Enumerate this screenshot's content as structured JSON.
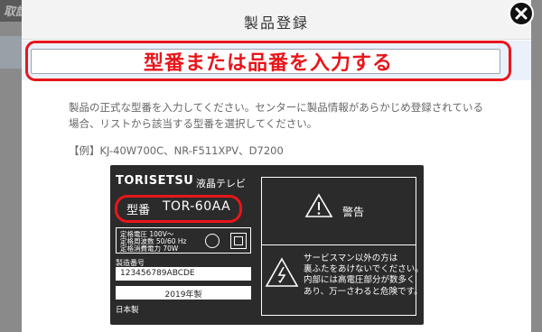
{
  "background": {
    "logo_text": "取説プラス"
  },
  "modal": {
    "title": "製品登録",
    "input_value": "",
    "callout": "型番または品番を入力する",
    "description": "製品の正式な型番を入力してください。センターに製品情報があらかじめ登録されている場合、リストから該当する型番を選択してください。",
    "example": "【例】KJ-40W700C、NR-F511XPV、D7200"
  },
  "plate": {
    "brand": "TORISETSU",
    "product": "液晶テレビ",
    "model_label": "型番",
    "model_value": "TOR-60AA",
    "spec_lines": [
      "定格電圧 100V〜",
      "定格周波数 50/60 Hz",
      "定格消費電力 70W"
    ],
    "serial_label": "製造番号",
    "serial_value": "123456789ABCDE",
    "year": "2019年製",
    "origin": "日本製",
    "warning_title": "警告",
    "warning_lines": [
      "サービスマン以外の方は",
      "裏ふたをあけないでください。",
      "内部には高電圧部分が数多く",
      "あり、万一さわると危険です。"
    ]
  },
  "icons": {
    "close": "close-icon",
    "warning": "warning-triangle-icon",
    "shock": "electric-shock-icon"
  },
  "colors": {
    "accent_red": "#e8161b",
    "plate_bg": "#2b2b2b"
  }
}
